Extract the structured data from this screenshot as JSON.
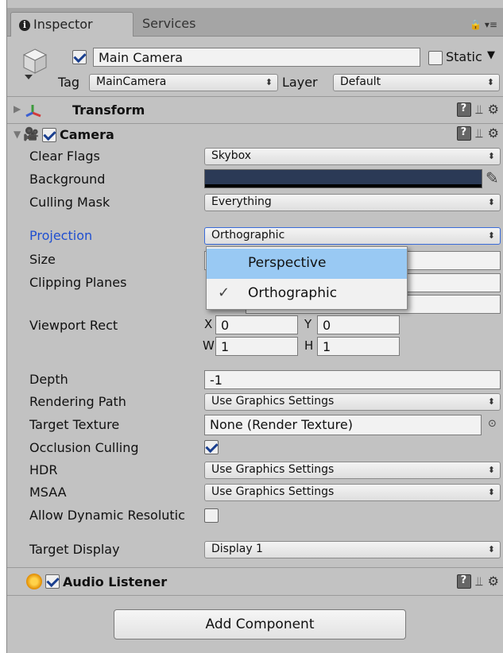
{
  "tabs": {
    "inspector": "Inspector",
    "services": "Services"
  },
  "header": {
    "name_value": "Main Camera",
    "static_label": "Static",
    "tag_label": "Tag",
    "tag_value": "MainCamera",
    "layer_label": "Layer",
    "layer_value": "Default"
  },
  "components": {
    "transform": "Transform",
    "camera": "Camera",
    "audio_listener": "Audio Listener"
  },
  "camera": {
    "clear_flags_label": "Clear Flags",
    "clear_flags_value": "Skybox",
    "background_label": "Background",
    "background_color": "#2b3a56",
    "culling_mask_label": "Culling Mask",
    "culling_mask_value": "Everything",
    "projection_label": "Projection",
    "projection_value": "Orthographic",
    "size_label": "Size",
    "clipping_label": "Clipping Planes",
    "viewport_label": "Viewport Rect",
    "viewport": {
      "x_label": "X",
      "x": "0",
      "y_label": "Y",
      "y": "0",
      "w_label": "W",
      "w": "1",
      "h_label": "H",
      "h": "1"
    },
    "depth_label": "Depth",
    "depth_value": "-1",
    "rendering_path_label": "Rendering Path",
    "rendering_path_value": "Use Graphics Settings",
    "target_texture_label": "Target Texture",
    "target_texture_value": "None (Render Texture)",
    "occlusion_label": "Occlusion Culling",
    "hdr_label": "HDR",
    "hdr_value": "Use Graphics Settings",
    "msaa_label": "MSAA",
    "msaa_value": "Use Graphics Settings",
    "dynamic_res_label": "Allow Dynamic Resolutic",
    "target_display_label": "Target Display",
    "target_display_value": "Display 1"
  },
  "popup": {
    "items": [
      "Perspective",
      "Orthographic"
    ],
    "selected_index": 1,
    "highlighted_index": 0
  },
  "add_component_label": "Add Component",
  "colors": {
    "highlight": "#99c9f3",
    "projection_label": "#1f4fd0",
    "panel": "#c2c2c2"
  }
}
